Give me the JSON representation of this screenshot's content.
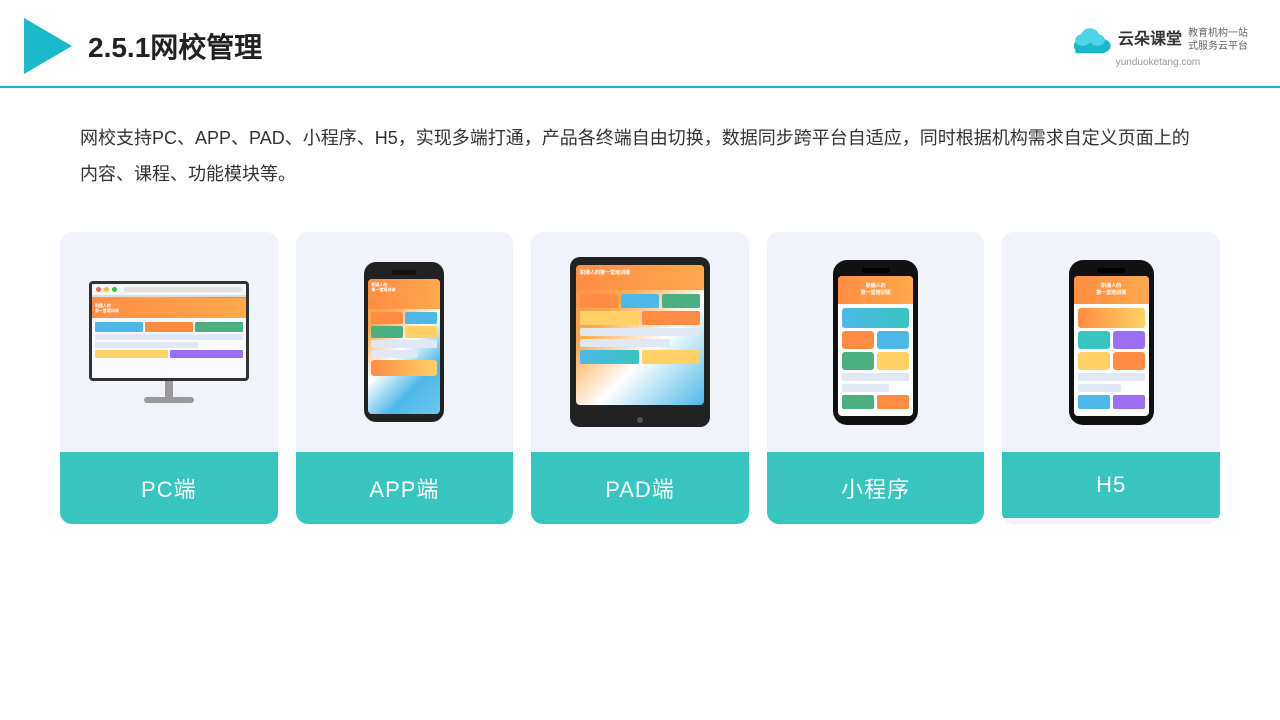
{
  "header": {
    "title": "2.5.1网校管理",
    "brand_name_cn": "云朵课堂",
    "brand_tagline_line1": "教育机构一站",
    "brand_tagline_line2": "式服务云平台",
    "brand_url": "yunduoketang.com"
  },
  "description": {
    "text": "网校支持PC、APP、PAD、小程序、H5，实现多端打通，产品各终端自由切换，数据同步跨平台自适应，同时根据机构需求自定义页面上的内容、课程、功能模块等。"
  },
  "cards": [
    {
      "id": "pc",
      "label": "PC端"
    },
    {
      "id": "app",
      "label": "APP端"
    },
    {
      "id": "pad",
      "label": "PAD端"
    },
    {
      "id": "miniprogram",
      "label": "小程序"
    },
    {
      "id": "h5",
      "label": "H5"
    }
  ],
  "colors": {
    "accent": "#1ab8c8",
    "card_label_bg": "#38c5c0",
    "card_bg": "#f0f4fa"
  }
}
